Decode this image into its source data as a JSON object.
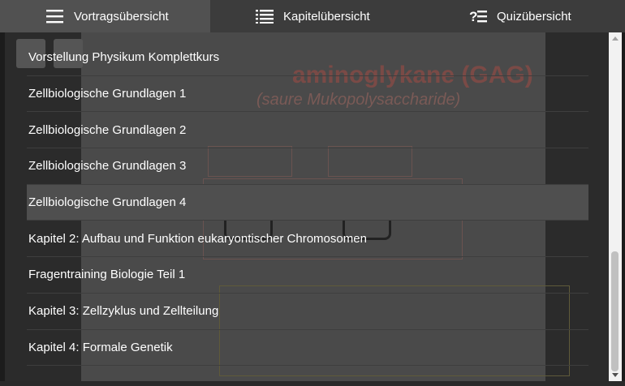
{
  "tabs": [
    {
      "label": "Vortragsübersicht",
      "icon": "hamburger-icon",
      "active": true
    },
    {
      "label": "Kapitelübersicht",
      "icon": "list-icon",
      "active": false
    },
    {
      "label": "Quizübersicht",
      "icon": "quiz-list-icon",
      "active": false
    }
  ],
  "menu": {
    "items": [
      {
        "label": "Vorstellung Physikum Komplettkurs"
      },
      {
        "label": "Zellbiologische Grundlagen 1"
      },
      {
        "label": "Zellbiologische Grundlagen 2"
      },
      {
        "label": "Zellbiologische Grundlagen 3"
      },
      {
        "label": "Zellbiologische Grundlagen 4"
      },
      {
        "label": "Kapitel 2: Aufbau und Funktion eukaryontischer Chromosomen"
      },
      {
        "label": "Fragentraining Biologie Teil 1"
      },
      {
        "label": "Kapitel 3: Zellzyklus und Zellteilung"
      },
      {
        "label": "Kapitel 4: Formale Genetik"
      }
    ],
    "active_index": 4
  },
  "background_slide": {
    "title": "aminoglykane (GAG)",
    "subtitle": "(saure Mukopolysaccharide)"
  },
  "colors": {
    "tabbar": "#3c3c3c",
    "active_tab": "#515151",
    "active_item": "#4f4f4f",
    "text": "#ffffff"
  }
}
